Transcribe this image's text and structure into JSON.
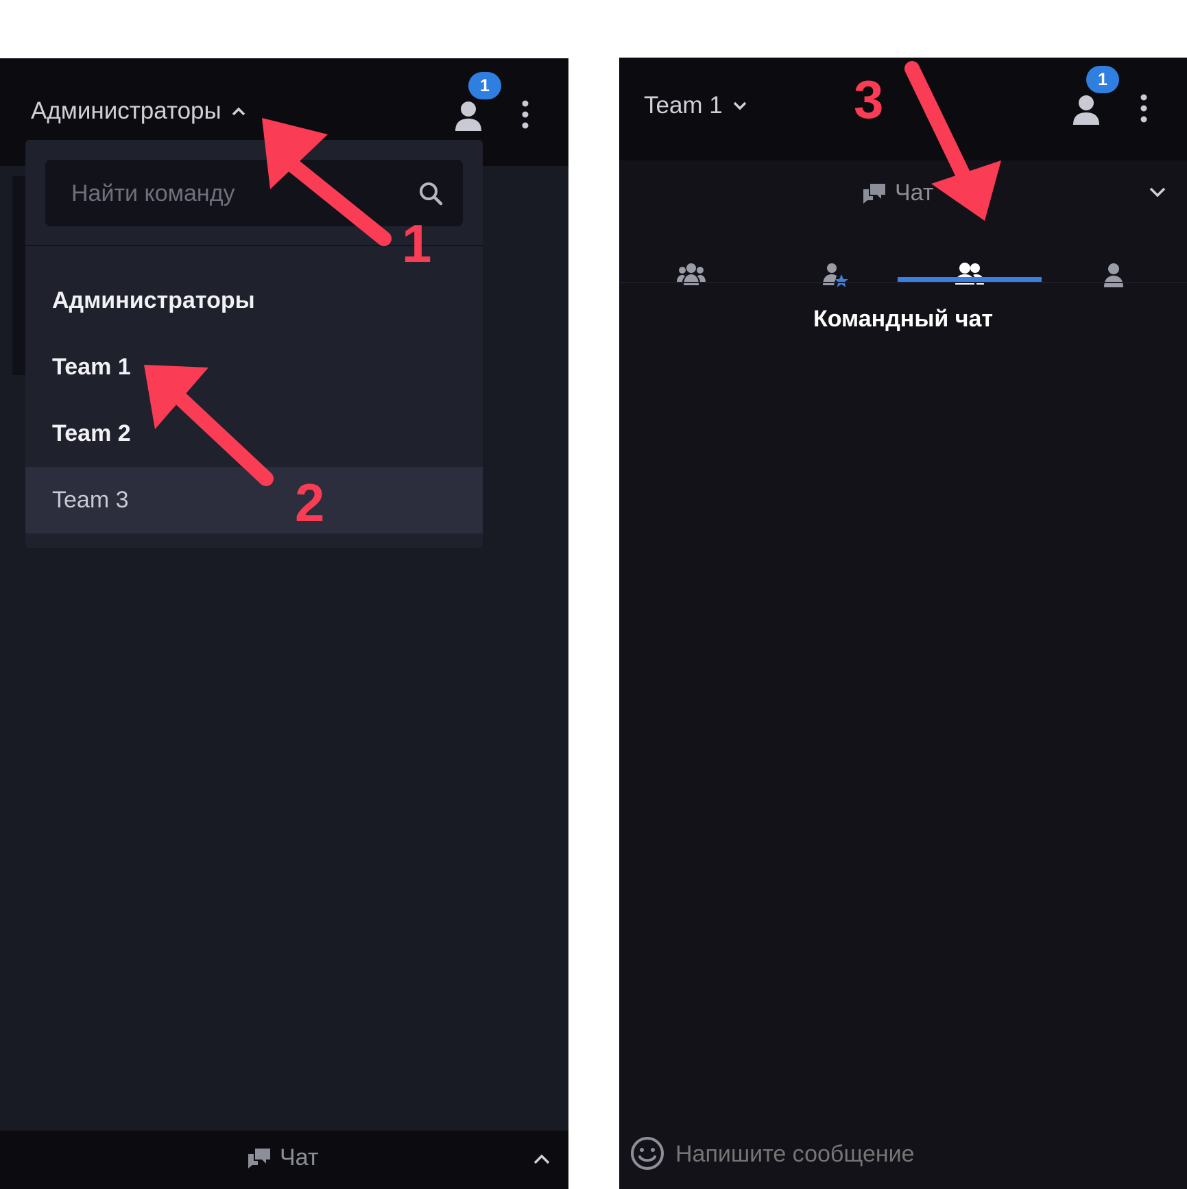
{
  "left": {
    "header_title": "Администраторы",
    "badge_count": "1",
    "search_placeholder": "Найти команду",
    "teams": [
      "Администраторы",
      "Team 1",
      "Team 2",
      "Team 3"
    ],
    "chat_label": "Чат"
  },
  "right": {
    "header_title": "Team 1",
    "badge_count": "1",
    "chat_label": "Чат",
    "tabs": [
      "all-teams",
      "favorites",
      "team-chat",
      "private"
    ],
    "active_tab": "team-chat",
    "room_title": "Командный чат",
    "message_placeholder": "Напишите сообщение"
  },
  "annotations": [
    "1",
    "2",
    "3"
  ],
  "colors": {
    "accent": "#2f7fe0",
    "annotation": "#fa3c55",
    "panel_bg": "#181a24",
    "topbar_bg": "#0c0c10"
  }
}
